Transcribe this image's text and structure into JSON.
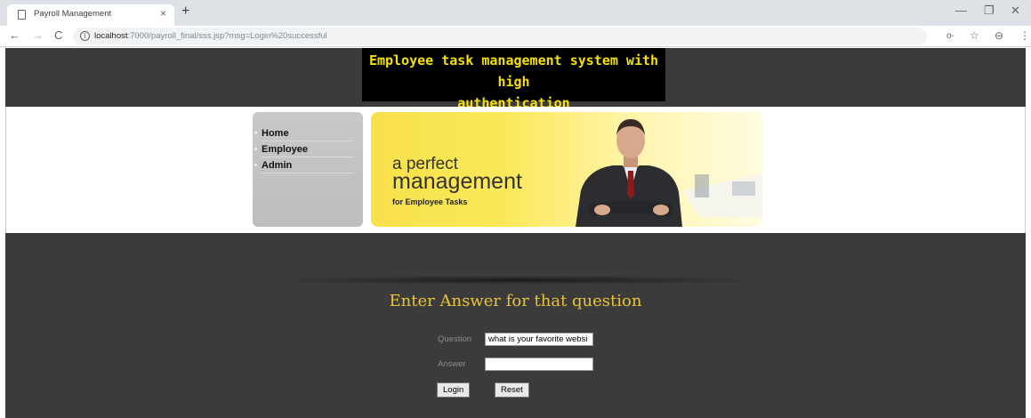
{
  "browser": {
    "tab_title": "Payroll Management",
    "tab_close": "×",
    "new_tab": "+",
    "url_host": "localhost",
    "url_rest": ":7000/payroll_final/sss.jsp?msg=Login%20successful",
    "info_symbol": "i",
    "back": "←",
    "forward": "→",
    "reload": "C",
    "key_icon": "o-",
    "star_icon": "☆",
    "profile_icon": "⊖",
    "menu_icon": "⋮",
    "minimize": "—",
    "restore": "❐",
    "close": "✕"
  },
  "header": {
    "title_line1": "Employee task management system with high",
    "title_line2": "authentication"
  },
  "menu": {
    "items": [
      {
        "label": "Home"
      },
      {
        "label": "Employee"
      },
      {
        "label": "Admin"
      }
    ]
  },
  "banner": {
    "line1": "a perfect",
    "line2": "management",
    "line3": "for Employee Tasks"
  },
  "form": {
    "heading": "Enter Answer for that question",
    "question_label": "Question",
    "question_value": "what is your favorite websi",
    "answer_label": "Answer",
    "answer_value": "",
    "login_label": "Login",
    "reset_label": "Reset"
  },
  "colors": {
    "dark_band": "#3b3b3b",
    "title_text": "#f5e000",
    "heading_gold": "#e8c43a",
    "banner_yellow": "#f7e04a"
  }
}
